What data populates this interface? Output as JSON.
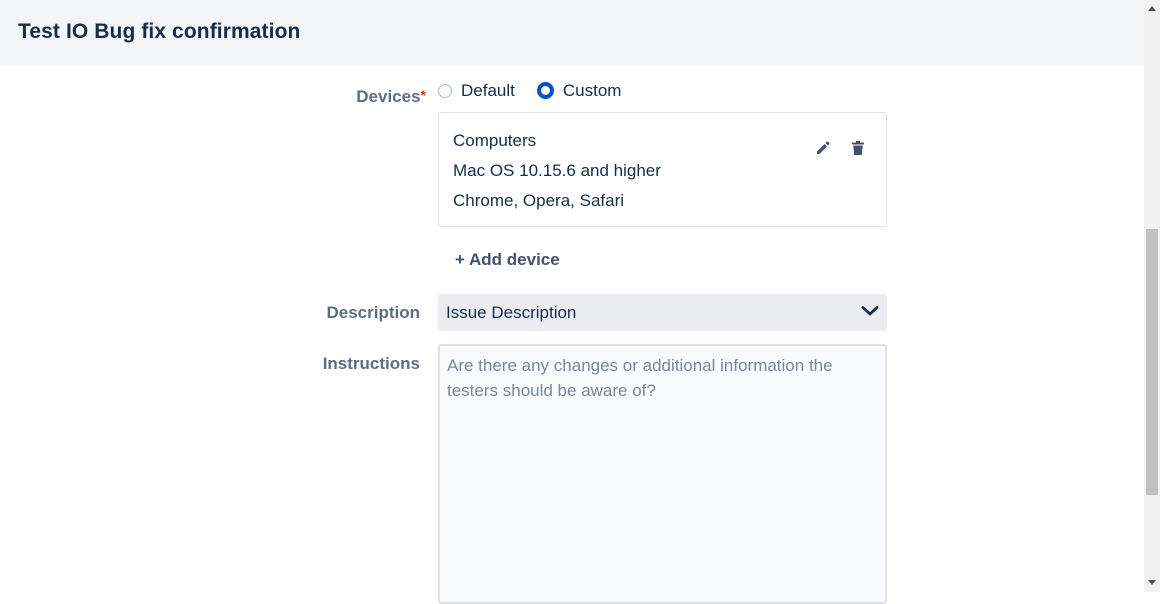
{
  "header": {
    "title": "Test IO Bug fix confirmation"
  },
  "devices": {
    "label": "Devices",
    "required_marker": "*",
    "options": [
      {
        "label": "Default",
        "selected": false
      },
      {
        "label": "Custom",
        "selected": true
      }
    ],
    "card": {
      "lines": [
        "Computers",
        "Mac OS 10.15.6 and higher",
        "Chrome, Opera, Safari"
      ],
      "edit_icon": "pencil-icon",
      "delete_icon": "trash-icon"
    },
    "add_label": "+ Add device"
  },
  "description": {
    "label": "Description",
    "value": "Issue Description",
    "icon": "chevron-down-icon"
  },
  "instructions": {
    "label": "Instructions",
    "placeholder": "Are there any changes or additional information the testers should be aware of?"
  },
  "colors": {
    "accent": "#0052cc",
    "header_bg": "#f4f5f7",
    "label": "#5e6c84",
    "required": "#de350b"
  }
}
